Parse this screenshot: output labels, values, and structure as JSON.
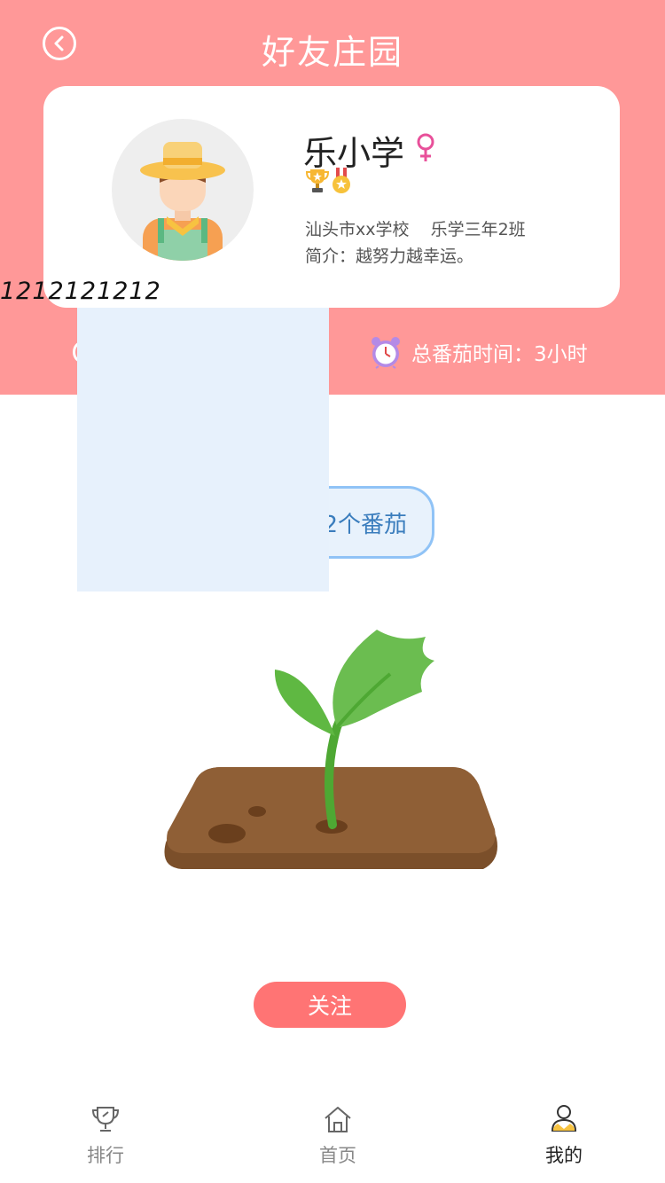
{
  "header": {
    "title": "好友庄园",
    "back_icon": "chevron-left-icon",
    "background_color": "#ff9898"
  },
  "profile": {
    "name": "乐小学",
    "gender_icon": "female-icon",
    "gender_color": "#e8509a",
    "badges": [
      "trophy-icon",
      "medal-icon"
    ],
    "school": "汕头市xx学校",
    "class": "乐学三年2班",
    "bio": "简介：越努力越幸运。"
  },
  "overflow_text": "1212121212",
  "stats": {
    "tomato_time_label": "总番茄时间：3小时"
  },
  "bubble": {
    "text": "2个番茄"
  },
  "actions": {
    "follow_label": "关注",
    "follow_color": "#ff7474"
  },
  "tabbar": {
    "items": [
      {
        "label": "排行",
        "icon": "trophy-outline-icon",
        "active": false
      },
      {
        "label": "首页",
        "icon": "home-icon",
        "active": false
      },
      {
        "label": "我的",
        "icon": "user-icon",
        "active": true
      }
    ]
  }
}
